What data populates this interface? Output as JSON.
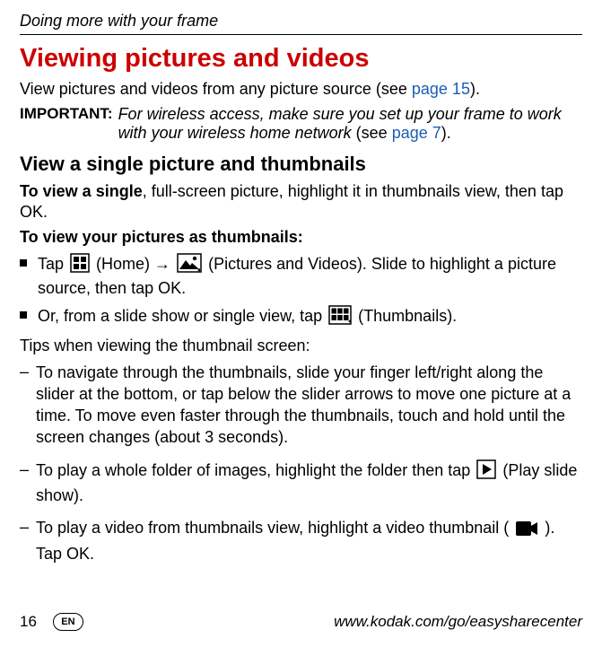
{
  "header": "Doing more with your frame",
  "title": "Viewing pictures and videos",
  "intro_a": "View pictures and videos from any picture source (see ",
  "intro_link": "page 15",
  "intro_b": ").",
  "important": {
    "label": "IMPORTANT:",
    "text_a": "For wireless access, make sure you set up your frame to work with your wireless home network",
    "text_b": " (see ",
    "link": "page 7",
    "text_c": ")."
  },
  "subtitle": "View a single picture and thumbnails",
  "single_a": "To view a single",
  "single_b": ", full-screen picture, highlight it in thumbnails view, then tap OK.",
  "thumbs_heading": "To view your pictures as thumbnails:",
  "bullets": {
    "b1a": "Tap ",
    "b1b": " (Home) → ",
    "b1c": " (Pictures and Videos). Slide to highlight a picture source, then tap OK.",
    "b2a": "Or, from a slide show or single view, tap ",
    "b2b": " (Thumbnails)."
  },
  "tips_intro": "Tips when viewing the thumbnail screen:",
  "dashes": {
    "d1": "To navigate through the thumbnails, slide your finger left/right along the slider at the bottom, or tap below the slider arrows to move one picture at a time. To move even faster through the thumbnails, touch and hold until the screen changes (about 3 seconds).",
    "d2a": "To play a whole folder of images, highlight the folder then tap ",
    "d2b": " (Play slide show).",
    "d3a": "To play a video from thumbnails view, highlight a video thumbnail (",
    "d3b": "). Tap OK."
  },
  "footer": {
    "page": "16",
    "lang": "EN",
    "url": "www.kodak.com/go/easysharecenter"
  }
}
